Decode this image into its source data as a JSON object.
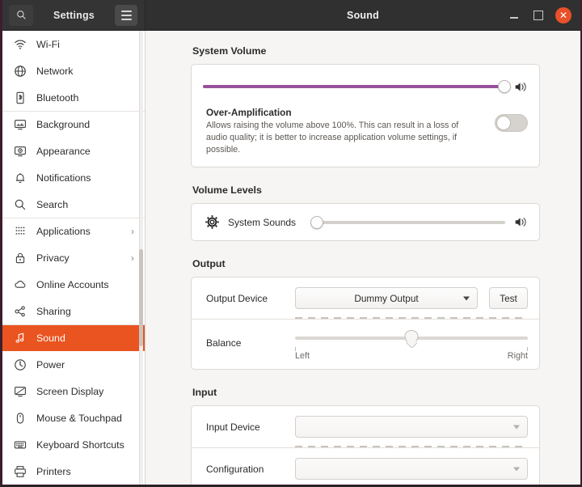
{
  "titlebar": {
    "left_title": "Settings",
    "main_title": "Sound",
    "search_icon": "search-icon",
    "menu_icon": "hamburger-menu-icon",
    "minimize": "–",
    "maximize": "□",
    "close": "✕"
  },
  "sidebar": {
    "items": [
      {
        "label": "Wi-Fi",
        "icon": "wifi-icon",
        "chevron": "",
        "active": false,
        "separator": false
      },
      {
        "label": "Network",
        "icon": "network-globe-icon",
        "chevron": "",
        "active": false,
        "separator": false
      },
      {
        "label": "Bluetooth",
        "icon": "bluetooth-icon",
        "chevron": "",
        "active": false,
        "separator": false
      },
      {
        "label": "Background",
        "icon": "background-icon",
        "chevron": "",
        "active": false,
        "separator": true
      },
      {
        "label": "Appearance",
        "icon": "appearance-icon",
        "chevron": "",
        "active": false,
        "separator": false
      },
      {
        "label": "Notifications",
        "icon": "bell-icon",
        "chevron": "",
        "active": false,
        "separator": false
      },
      {
        "label": "Search",
        "icon": "search-icon",
        "chevron": "",
        "active": false,
        "separator": false
      },
      {
        "label": "Applications",
        "icon": "applications-grid-icon",
        "chevron": "›",
        "active": false,
        "separator": true
      },
      {
        "label": "Privacy",
        "icon": "lock-icon",
        "chevron": "›",
        "active": false,
        "separator": false
      },
      {
        "label": "Online Accounts",
        "icon": "cloud-icon",
        "chevron": "",
        "active": false,
        "separator": false
      },
      {
        "label": "Sharing",
        "icon": "share-nodes-icon",
        "chevron": "",
        "active": false,
        "separator": false
      },
      {
        "label": "Sound",
        "icon": "music-note-icon",
        "chevron": "",
        "active": true,
        "separator": true
      },
      {
        "label": "Power",
        "icon": "power-icon",
        "chevron": "",
        "active": false,
        "separator": false
      },
      {
        "label": "Screen Display",
        "icon": "screen-display-icon",
        "chevron": "",
        "active": false,
        "separator": false
      },
      {
        "label": "Mouse & Touchpad",
        "icon": "mouse-icon",
        "chevron": "",
        "active": false,
        "separator": false
      },
      {
        "label": "Keyboard Shortcuts",
        "icon": "keyboard-icon",
        "chevron": "",
        "active": false,
        "separator": false
      },
      {
        "label": "Printers",
        "icon": "printer-icon",
        "chevron": "",
        "active": false,
        "separator": false
      }
    ]
  },
  "main": {
    "system_volume": {
      "title": "System Volume",
      "slider_value": 100,
      "speaker_icon": "speaker-volume-icon",
      "over_amplification": {
        "title": "Over-Amplification",
        "description": "Allows raising the volume above 100%. This can result in a loss of audio quality; it is better to increase application volume settings, if possible.",
        "toggle_state": "off"
      }
    },
    "volume_levels": {
      "title": "Volume Levels",
      "rows": [
        {
          "name": "System Sounds",
          "icon": "gear-icon",
          "slider_value": 0,
          "speaker_icon": "speaker-volume-icon"
        }
      ]
    },
    "output": {
      "title": "Output",
      "device_label": "Output Device",
      "device_value": "Dummy Output",
      "test_button": "Test",
      "balance_label": "Balance",
      "balance_value": 50,
      "balance_left": "Left",
      "balance_right": "Right"
    },
    "input": {
      "title": "Input",
      "device_label": "Input Device",
      "device_value": "",
      "configuration_label": "Configuration",
      "configuration_value": ""
    }
  },
  "colors": {
    "accent_orange": "#e95420",
    "slider_purple": "#97519b",
    "titlebar": "#303030",
    "content_bg": "#f6f5f4"
  }
}
